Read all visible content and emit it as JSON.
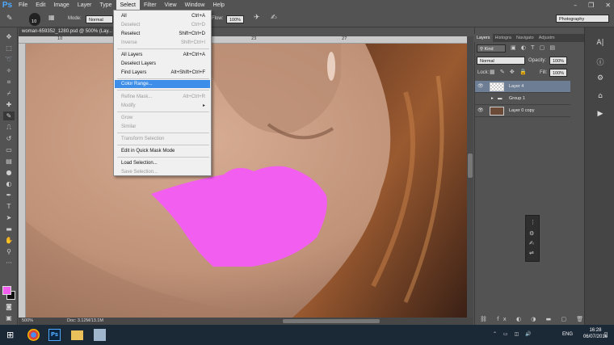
{
  "app": {
    "logo": "Ps"
  },
  "menu": [
    "File",
    "Edit",
    "Image",
    "Layer",
    "Type",
    "Select",
    "Filter",
    "View",
    "Window",
    "Help"
  ],
  "options": {
    "brush_size": "10",
    "mode_label": "Mode:",
    "mode_value": "Normal",
    "flow_label": "Flow:",
    "flow_value": "100%",
    "workspace": "Photography"
  },
  "document": {
    "tab_title": "woman-659352_1280.psd @ 500% (Lay..."
  },
  "ruler": {
    "top_ticks": [
      "10",
      "16",
      "23",
      "27"
    ],
    "left_ticks": [
      "0",
      "2",
      "4",
      "6",
      "8",
      "10"
    ]
  },
  "status": {
    "zoom": "500%",
    "doc": "Doc: 3.12M/13.1M"
  },
  "select_menu": {
    "items": [
      {
        "label": "All",
        "shortcut": "Ctrl+A",
        "disabled": false
      },
      {
        "label": "Deselect",
        "shortcut": "Ctrl+D",
        "disabled": true
      },
      {
        "label": "Reselect",
        "shortcut": "Shift+Ctrl+D",
        "disabled": false
      },
      {
        "label": "Inverse",
        "shortcut": "Shift+Ctrl+I",
        "disabled": true
      },
      {
        "label": "All Layers",
        "shortcut": "Alt+Ctrl+A",
        "disabled": false
      },
      {
        "label": "Deselect Layers",
        "shortcut": "",
        "disabled": false
      },
      {
        "label": "Find Layers",
        "shortcut": "Alt+Shift+Ctrl+F",
        "disabled": false
      },
      {
        "label": "Color Range...",
        "shortcut": "",
        "disabled": false
      },
      {
        "label": "Refine Mask...",
        "shortcut": "Alt+Ctrl+R",
        "disabled": true
      },
      {
        "label": "Modify",
        "shortcut": "▸",
        "disabled": true
      },
      {
        "label": "Grow",
        "shortcut": "",
        "disabled": true
      },
      {
        "label": "Similar",
        "shortcut": "",
        "disabled": true
      },
      {
        "label": "Transform Selection",
        "shortcut": "",
        "disabled": true
      },
      {
        "label": "Edit in Quick Mask Mode",
        "shortcut": "",
        "disabled": false
      },
      {
        "label": "Load Selection...",
        "shortcut": "",
        "disabled": false
      },
      {
        "label": "Save Selection...",
        "shortcut": "",
        "disabled": true
      }
    ]
  },
  "layers_panel": {
    "tabs": [
      "Layers",
      "Histogra",
      "Navigato",
      "Adjustm"
    ],
    "kind_label": "Kind",
    "blend_mode": "Normal",
    "opacity_label": "Opacity:",
    "opacity_value": "100%",
    "lock_label": "Lock:",
    "fill_label": "Fill:",
    "fill_value": "100%",
    "layers": [
      {
        "name": "Layer 4",
        "visible": true,
        "selected": true
      },
      {
        "name": "Group 1",
        "visible": false,
        "selected": false
      },
      {
        "name": "Layer 0 copy",
        "visible": true,
        "selected": false
      }
    ]
  },
  "taskbar": {
    "lang": "ENG",
    "time": "16:28",
    "date": "06/07/2016"
  },
  "colors": {
    "lip_pink": "#f25ef0",
    "menu_highlight": "#3d8ee8",
    "foreground_swatch": "#f25ef0",
    "background_swatch": "#111111"
  }
}
